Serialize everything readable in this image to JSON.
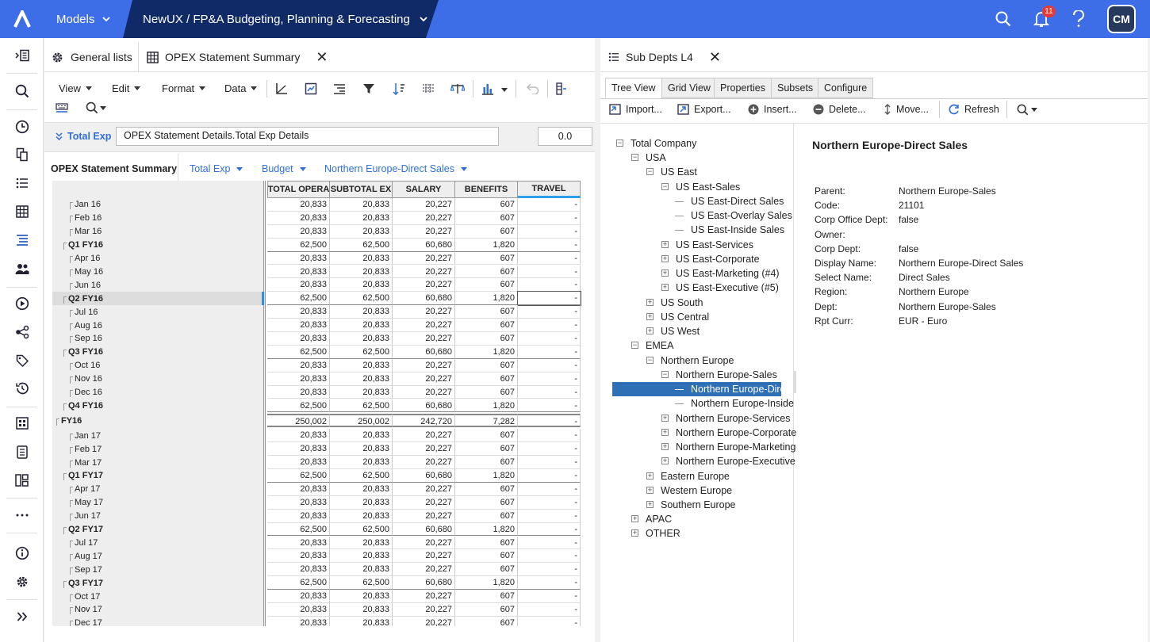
{
  "app": {
    "models_label": "Models",
    "breadcrumb": "NewUX / FP&A Budgeting, Planning & Forecasting",
    "notifications": "11",
    "user_initials": "CM"
  },
  "left_tabs": [
    {
      "label": "General lists"
    },
    {
      "label": "OPEX Statement Summary"
    }
  ],
  "menus": [
    "View",
    "Edit",
    "Format",
    "Data"
  ],
  "formula": {
    "dimension": "Total Exp",
    "value": "OPEX Statement Details.Total Exp Details",
    "number": "0.0"
  },
  "pivot": {
    "title": "OPEX Statement Summary",
    "selectors": [
      "Total Exp",
      "Budget",
      "Northern Europe-Direct Sales"
    ]
  },
  "columns": [
    "TOTAL OPERA",
    "SUBTOTAL EX",
    "SALARY",
    "BENEFITS",
    "TRAVEL"
  ],
  "rows": [
    {
      "label": "Jan 16",
      "level": 2,
      "values": [
        "20,833",
        "20,833",
        "20,227",
        "607",
        "-"
      ]
    },
    {
      "label": "Feb 16",
      "level": 2,
      "values": [
        "20,833",
        "20,833",
        "20,227",
        "607",
        "-"
      ]
    },
    {
      "label": "Mar 16",
      "level": 2,
      "values": [
        "20,833",
        "20,833",
        "20,227",
        "607",
        "-"
      ]
    },
    {
      "label": "Q1 FY16",
      "level": 1,
      "values": [
        "62,500",
        "62,500",
        "60,680",
        "1,820",
        "-"
      ]
    },
    {
      "label": "Apr 16",
      "level": 2,
      "values": [
        "20,833",
        "20,833",
        "20,227",
        "607",
        "-"
      ]
    },
    {
      "label": "May 16",
      "level": 2,
      "values": [
        "20,833",
        "20,833",
        "20,227",
        "607",
        "-"
      ]
    },
    {
      "label": "Jun 16",
      "level": 2,
      "values": [
        "20,833",
        "20,833",
        "20,227",
        "607",
        "-"
      ]
    },
    {
      "label": "Q2 FY16",
      "level": 1,
      "values": [
        "62,500",
        "62,500",
        "60,680",
        "1,820",
        "-"
      ]
    },
    {
      "label": "Jul 16",
      "level": 2,
      "values": [
        "20,833",
        "20,833",
        "20,227",
        "607",
        "-"
      ]
    },
    {
      "label": "Aug 16",
      "level": 2,
      "values": [
        "20,833",
        "20,833",
        "20,227",
        "607",
        "-"
      ]
    },
    {
      "label": "Sep 16",
      "level": 2,
      "values": [
        "20,833",
        "20,833",
        "20,227",
        "607",
        "-"
      ]
    },
    {
      "label": "Q3 FY16",
      "level": 1,
      "values": [
        "62,500",
        "62,500",
        "60,680",
        "1,820",
        "-"
      ]
    },
    {
      "label": "Oct 16",
      "level": 2,
      "values": [
        "20,833",
        "20,833",
        "20,227",
        "607",
        "-"
      ]
    },
    {
      "label": "Nov 16",
      "level": 2,
      "values": [
        "20,833",
        "20,833",
        "20,227",
        "607",
        "-"
      ]
    },
    {
      "label": "Dec 16",
      "level": 2,
      "values": [
        "20,833",
        "20,833",
        "20,227",
        "607",
        "-"
      ]
    },
    {
      "label": "Q4 FY16",
      "level": 1,
      "values": [
        "62,500",
        "62,500",
        "60,680",
        "1,820",
        "-"
      ]
    },
    {
      "label": "FY16",
      "level": 0,
      "values": [
        "250,002",
        "250,002",
        "242,720",
        "7,282",
        "-"
      ]
    },
    {
      "label": "Jan 17",
      "level": 2,
      "values": [
        "20,833",
        "20,833",
        "20,227",
        "607",
        "-"
      ]
    },
    {
      "label": "Feb 17",
      "level": 2,
      "values": [
        "20,833",
        "20,833",
        "20,227",
        "607",
        "-"
      ]
    },
    {
      "label": "Mar 17",
      "level": 2,
      "values": [
        "20,833",
        "20,833",
        "20,227",
        "607",
        "-"
      ]
    },
    {
      "label": "Q1 FY17",
      "level": 1,
      "values": [
        "62,500",
        "62,500",
        "60,680",
        "1,820",
        "-"
      ]
    },
    {
      "label": "Apr 17",
      "level": 2,
      "values": [
        "20,833",
        "20,833",
        "20,227",
        "607",
        "-"
      ]
    },
    {
      "label": "May 17",
      "level": 2,
      "values": [
        "20,833",
        "20,833",
        "20,227",
        "607",
        "-"
      ]
    },
    {
      "label": "Jun 17",
      "level": 2,
      "values": [
        "20,833",
        "20,833",
        "20,227",
        "607",
        "-"
      ]
    },
    {
      "label": "Q2 FY17",
      "level": 1,
      "values": [
        "62,500",
        "62,500",
        "60,680",
        "1,820",
        "-"
      ]
    },
    {
      "label": "Jul 17",
      "level": 2,
      "values": [
        "20,833",
        "20,833",
        "20,227",
        "607",
        "-"
      ]
    },
    {
      "label": "Aug 17",
      "level": 2,
      "values": [
        "20,833",
        "20,833",
        "20,227",
        "607",
        "-"
      ]
    },
    {
      "label": "Sep 17",
      "level": 2,
      "values": [
        "20,833",
        "20,833",
        "20,227",
        "607",
        "-"
      ]
    },
    {
      "label": "Q3 FY17",
      "level": 1,
      "values": [
        "62,500",
        "62,500",
        "60,680",
        "1,820",
        "-"
      ]
    },
    {
      "label": "Oct 17",
      "level": 2,
      "values": [
        "20,833",
        "20,833",
        "20,227",
        "607",
        "-"
      ]
    },
    {
      "label": "Nov 17",
      "level": 2,
      "values": [
        "20,833",
        "20,833",
        "20,227",
        "607",
        "-"
      ]
    },
    {
      "label": "Dec 17",
      "level": 2,
      "values": [
        "20,833",
        "20,833",
        "20,227",
        "607",
        "-"
      ]
    }
  ],
  "right_tab": {
    "label": "Sub Depts L4"
  },
  "sub_tabs": [
    "Tree View",
    "Grid View",
    "Properties",
    "Subsets",
    "Configure"
  ],
  "tree_tools": [
    "Import...",
    "Export...",
    "Insert...",
    "Delete...",
    "Move...",
    "Refresh"
  ],
  "tree": [
    {
      "label": "Total Company",
      "depth": 0,
      "toggle": "-"
    },
    {
      "label": "USA",
      "depth": 1,
      "toggle": "-"
    },
    {
      "label": "US East",
      "depth": 2,
      "toggle": "-"
    },
    {
      "label": "US East-Sales",
      "depth": 3,
      "toggle": "-"
    },
    {
      "label": "US East-Direct Sales",
      "depth": 4,
      "toggle": ""
    },
    {
      "label": "US East-Overlay Sales",
      "depth": 4,
      "toggle": ""
    },
    {
      "label": "US East-Inside Sales",
      "depth": 4,
      "toggle": ""
    },
    {
      "label": "US East-Services",
      "depth": 3,
      "toggle": "+"
    },
    {
      "label": "US East-Corporate",
      "depth": 3,
      "toggle": "+"
    },
    {
      "label": "US East-Marketing (#4)",
      "depth": 3,
      "toggle": "+"
    },
    {
      "label": "US East-Executive (#5)",
      "depth": 3,
      "toggle": "+"
    },
    {
      "label": "US South",
      "depth": 2,
      "toggle": "+"
    },
    {
      "label": "US Central",
      "depth": 2,
      "toggle": "+"
    },
    {
      "label": "US West",
      "depth": 2,
      "toggle": "+"
    },
    {
      "label": "EMEA",
      "depth": 1,
      "toggle": "-"
    },
    {
      "label": "Northern Europe",
      "depth": 2,
      "toggle": "-"
    },
    {
      "label": "Northern Europe-Sales",
      "depth": 3,
      "toggle": "-"
    },
    {
      "label": "Northern Europe-Dire",
      "depth": 4,
      "toggle": "",
      "selected": true
    },
    {
      "label": "Northern Europe-Inside",
      "depth": 4,
      "toggle": ""
    },
    {
      "label": "Northern Europe-Services",
      "depth": 3,
      "toggle": "+"
    },
    {
      "label": "Northern Europe-Corporate",
      "depth": 3,
      "toggle": "+"
    },
    {
      "label": "Northern Europe-Marketing",
      "depth": 3,
      "toggle": "+"
    },
    {
      "label": "Northern Europe-Executive",
      "depth": 3,
      "toggle": "+"
    },
    {
      "label": "Eastern Europe",
      "depth": 2,
      "toggle": "+"
    },
    {
      "label": "Western Europe",
      "depth": 2,
      "toggle": "+"
    },
    {
      "label": "Southern Europe",
      "depth": 2,
      "toggle": "+"
    },
    {
      "label": "APAC",
      "depth": 1,
      "toggle": "+"
    },
    {
      "label": "OTHER",
      "depth": 1,
      "toggle": "+"
    }
  ],
  "details": {
    "title": "Northern Europe-Direct Sales",
    "properties": [
      {
        "k": "Parent:",
        "v": "Northern Europe-Sales"
      },
      {
        "k": "Code:",
        "v": "21101"
      },
      {
        "k": "Corp Office Dept:",
        "v": "false"
      },
      {
        "k": "Owner:",
        "v": ""
      },
      {
        "k": "Corp Dept:",
        "v": "false"
      },
      {
        "k": "Display Name:",
        "v": "Northern Europe-Direct Sales"
      },
      {
        "k": "Select Name:",
        "v": "Direct Sales"
      },
      {
        "k": "Region:",
        "v": "Northern Europe"
      },
      {
        "k": "Dept:",
        "v": "Northern Europe-Sales"
      },
      {
        "k": "Rpt Curr:",
        "v": "EUR - Euro"
      }
    ]
  },
  "colors": {
    "primary": "#3d6ee8",
    "breadcrumb_bg": "#0f2a66",
    "selection": "#2f6fb5",
    "link": "#2f6fd6",
    "alert": "#e53935"
  }
}
